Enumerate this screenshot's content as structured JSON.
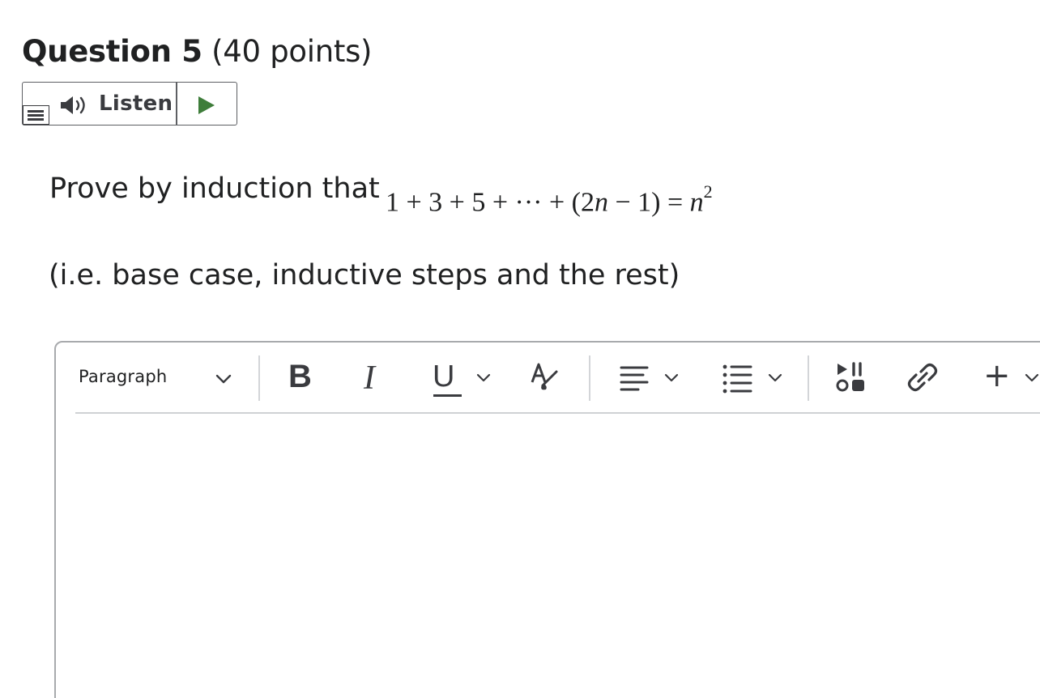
{
  "question": {
    "title_bold": "Question 5",
    "title_rest": "(40 points)"
  },
  "listen_widget": {
    "label": "Listen",
    "icons": [
      "menu-icon",
      "speaker-icon",
      "play-icon"
    ],
    "play_color": "#3e7d3a"
  },
  "prompt": {
    "text": "Prove by induction that",
    "math": {
      "part1": "1 + 3 + 5 + ··· + (2",
      "var1": "n",
      "part2": " − 1) = ",
      "var2": "n",
      "exp": "2"
    },
    "note": "(i.e. base case, inductive steps and the rest)"
  },
  "editor": {
    "block_format": "Paragraph",
    "toolbar": {
      "bold": "B",
      "italic": "I",
      "underline": "U",
      "insert": "+"
    },
    "icons": [
      "chevron-down-icon",
      "text-style-icon",
      "align-left-icon",
      "bulleted-list-icon",
      "insert-media-icon",
      "link-icon"
    ],
    "content": ""
  }
}
